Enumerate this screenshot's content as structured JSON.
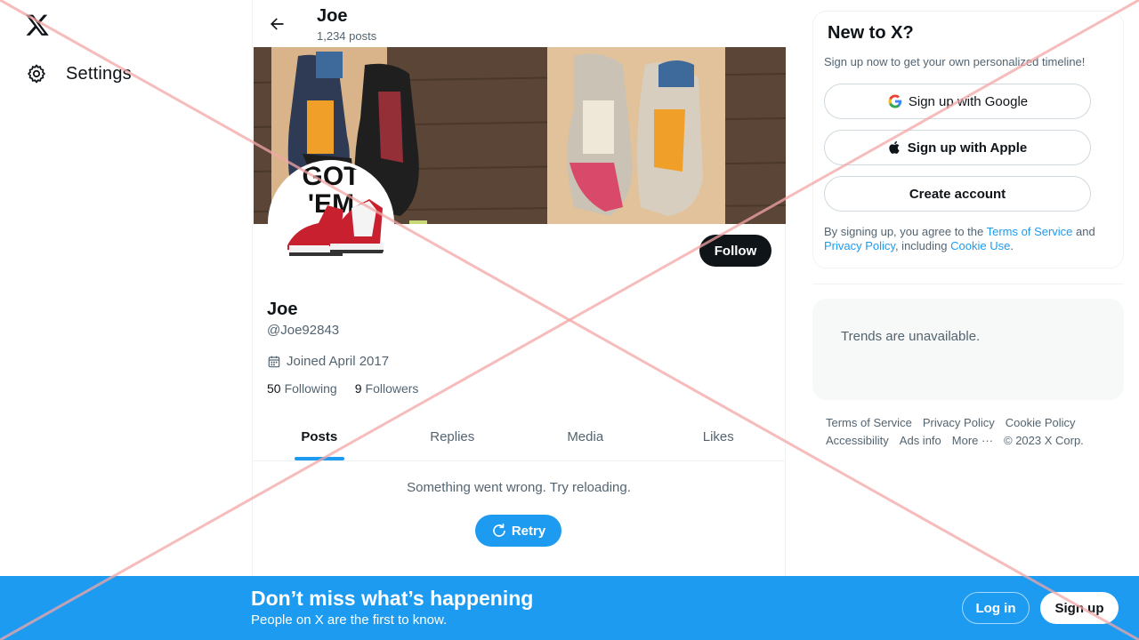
{
  "nav": {
    "logo": "x-logo",
    "settings_label": "Settings"
  },
  "header": {
    "name": "Joe",
    "posts_count": "1,234 posts"
  },
  "profile": {
    "name": "Joe",
    "handle": "@Joe92843",
    "joined": "Joined April 2017",
    "following_count": "50",
    "following_label": "Following",
    "followers_count": "9",
    "followers_label": "Followers",
    "follow_label": "Follow",
    "avatar_text": "GOT 'EM"
  },
  "tabs": [
    {
      "label": "Posts",
      "active": true
    },
    {
      "label": "Replies",
      "active": false
    },
    {
      "label": "Media",
      "active": false
    },
    {
      "label": "Likes",
      "active": false
    }
  ],
  "feed": {
    "error_message": "Something went wrong. Try reloading.",
    "retry_label": "Retry"
  },
  "signup_card": {
    "title": "New to X?",
    "subtitle": "Sign up now to get your own personalized timeline!",
    "google_label": "Sign up with Google",
    "apple_label": "Sign up with Apple",
    "create_label": "Create account",
    "legal_prefix": "By signing up, you agree to the ",
    "terms_link": "Terms of Service",
    "legal_and": " and ",
    "privacy_link": "Privacy Policy",
    "legal_including": ", including ",
    "cookie_link": "Cookie Use",
    "legal_suffix": "."
  },
  "trends": {
    "message": "Trends are unavailable."
  },
  "footer": {
    "terms": "Terms of Service",
    "privacy": "Privacy Policy",
    "cookie": "Cookie Policy",
    "accessibility": "Accessibility",
    "ads": "Ads info",
    "more": "More ···",
    "copyright": "© 2023 X Corp."
  },
  "bottom_bar": {
    "title": "Don’t miss what’s happening",
    "subtitle": "People on X are the first to know.",
    "login_label": "Log in",
    "signup_label": "Sign up"
  },
  "colors": {
    "accent": "#1d9bf0",
    "text_primary": "#0f1419",
    "text_secondary": "#536471",
    "cross": "#f4a6a6"
  }
}
